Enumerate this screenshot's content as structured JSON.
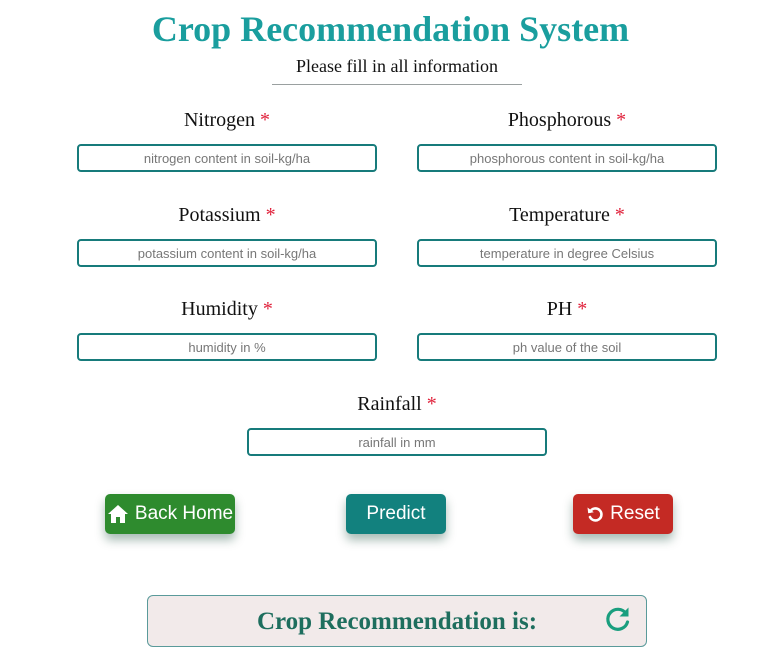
{
  "header": {
    "title": "Crop Recommendation System",
    "subtitle": "Please fill in all information"
  },
  "form": {
    "required_mark": "*",
    "fields": [
      {
        "label": "Nitrogen",
        "placeholder": "nitrogen content in soil-kg/ha"
      },
      {
        "label": "Phosphorous",
        "placeholder": "phosphorous content in soil-kg/ha"
      },
      {
        "label": "Potassium",
        "placeholder": "potassium content in soil-kg/ha"
      },
      {
        "label": "Temperature",
        "placeholder": "temperature in degree Celsius"
      },
      {
        "label": "Humidity",
        "placeholder": "humidity in %"
      },
      {
        "label": "PH",
        "placeholder": "ph value of the soil"
      },
      {
        "label": "Rainfall",
        "placeholder": "rainfall in mm"
      }
    ]
  },
  "buttons": {
    "home": {
      "label": "Back Home",
      "icon": "home-icon",
      "color": "#2e8b2e"
    },
    "predict": {
      "label": "Predict",
      "color": "#12817e"
    },
    "reset": {
      "label": "Reset",
      "icon": "undo-icon",
      "color": "#c42a24"
    }
  },
  "result": {
    "text": "Crop Recommendation is:",
    "icon": "refresh-icon"
  },
  "colors": {
    "accent": "#1a9e9e",
    "required": "#e0203a",
    "input_border": "#177b7b"
  }
}
